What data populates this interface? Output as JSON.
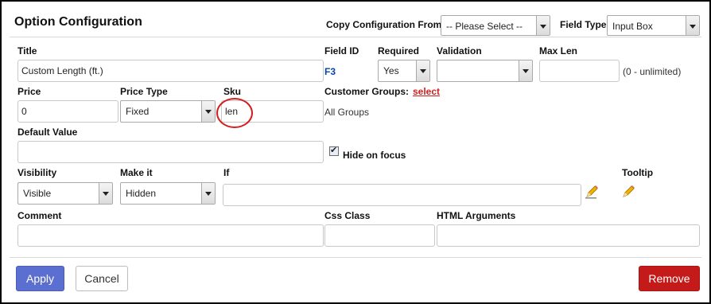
{
  "dialog": {
    "title": "Option Configuration",
    "copy_label": "Copy Configuration From:",
    "copy_value": "-- Please Select --",
    "field_type_label": "Field Type:",
    "field_type_value": "Input Box"
  },
  "row1": {
    "title_label": "Title",
    "title_value": "Custom Length (ft.)",
    "field_id_label": "Field ID",
    "field_id_value": "F3",
    "required_label": "Required",
    "required_value": "Yes",
    "validation_label": "Validation",
    "validation_value": "",
    "maxlen_label": "Max Len",
    "maxlen_value": "",
    "maxlen_hint": "(0 - unlimited)"
  },
  "row2": {
    "price_label": "Price",
    "price_value": "0",
    "price_type_label": "Price Type",
    "price_type_value": "Fixed",
    "sku_label": "Sku",
    "sku_value": "len",
    "customer_groups_label": "Customer Groups:",
    "customer_groups_link": "select",
    "customer_groups_value": "All Groups"
  },
  "row3": {
    "default_label": "Default Value",
    "default_value": "",
    "hide_on_focus_label": "Hide on focus",
    "hide_on_focus_checked": true
  },
  "row4": {
    "visibility_label": "Visibility",
    "visibility_value": "Visible",
    "make_it_label": "Make it",
    "make_it_value": "Hidden",
    "if_label": "If",
    "if_value": "",
    "tooltip_label": "Tooltip"
  },
  "row5": {
    "comment_label": "Comment",
    "comment_value": "",
    "css_label": "Css Class",
    "css_value": "",
    "html_label": "HTML Arguments",
    "html_value": ""
  },
  "footer": {
    "apply": "Apply",
    "cancel": "Cancel",
    "remove": "Remove"
  },
  "colors": {
    "apply_bg": "#5b6fd1",
    "remove_bg": "#c41a1a",
    "link_red": "#d21e1e",
    "annotation_circle": "#d21e1e"
  },
  "icons": [
    "pencil-icon",
    "checkbox-icon",
    "chevron-down-icon"
  ]
}
